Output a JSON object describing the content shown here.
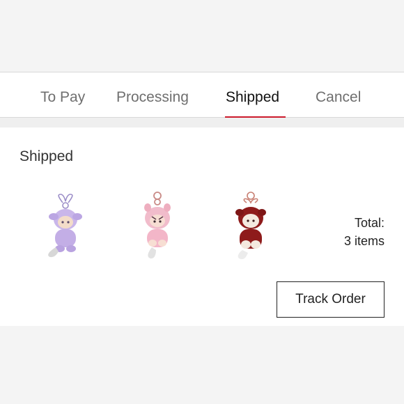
{
  "tabs": [
    {
      "label": "To Pay",
      "active": false
    },
    {
      "label": "Processing",
      "active": false
    },
    {
      "label": "Shipped",
      "active": true
    },
    {
      "label": "Cancel",
      "active": false
    }
  ],
  "accent_color": "#cc1a2b",
  "order": {
    "status": "Shipped",
    "items": [
      {
        "icon": "purple-plush-keychain-figure",
        "color": "#c9b6ea"
      },
      {
        "icon": "pink-plush-keychain-figure",
        "color": "#f1bccb"
      },
      {
        "icon": "red-plush-keychain-figure",
        "color": "#8e1b1b"
      }
    ],
    "total_label": "Total:",
    "total_value": "3 items",
    "track_label": "Track Order"
  }
}
